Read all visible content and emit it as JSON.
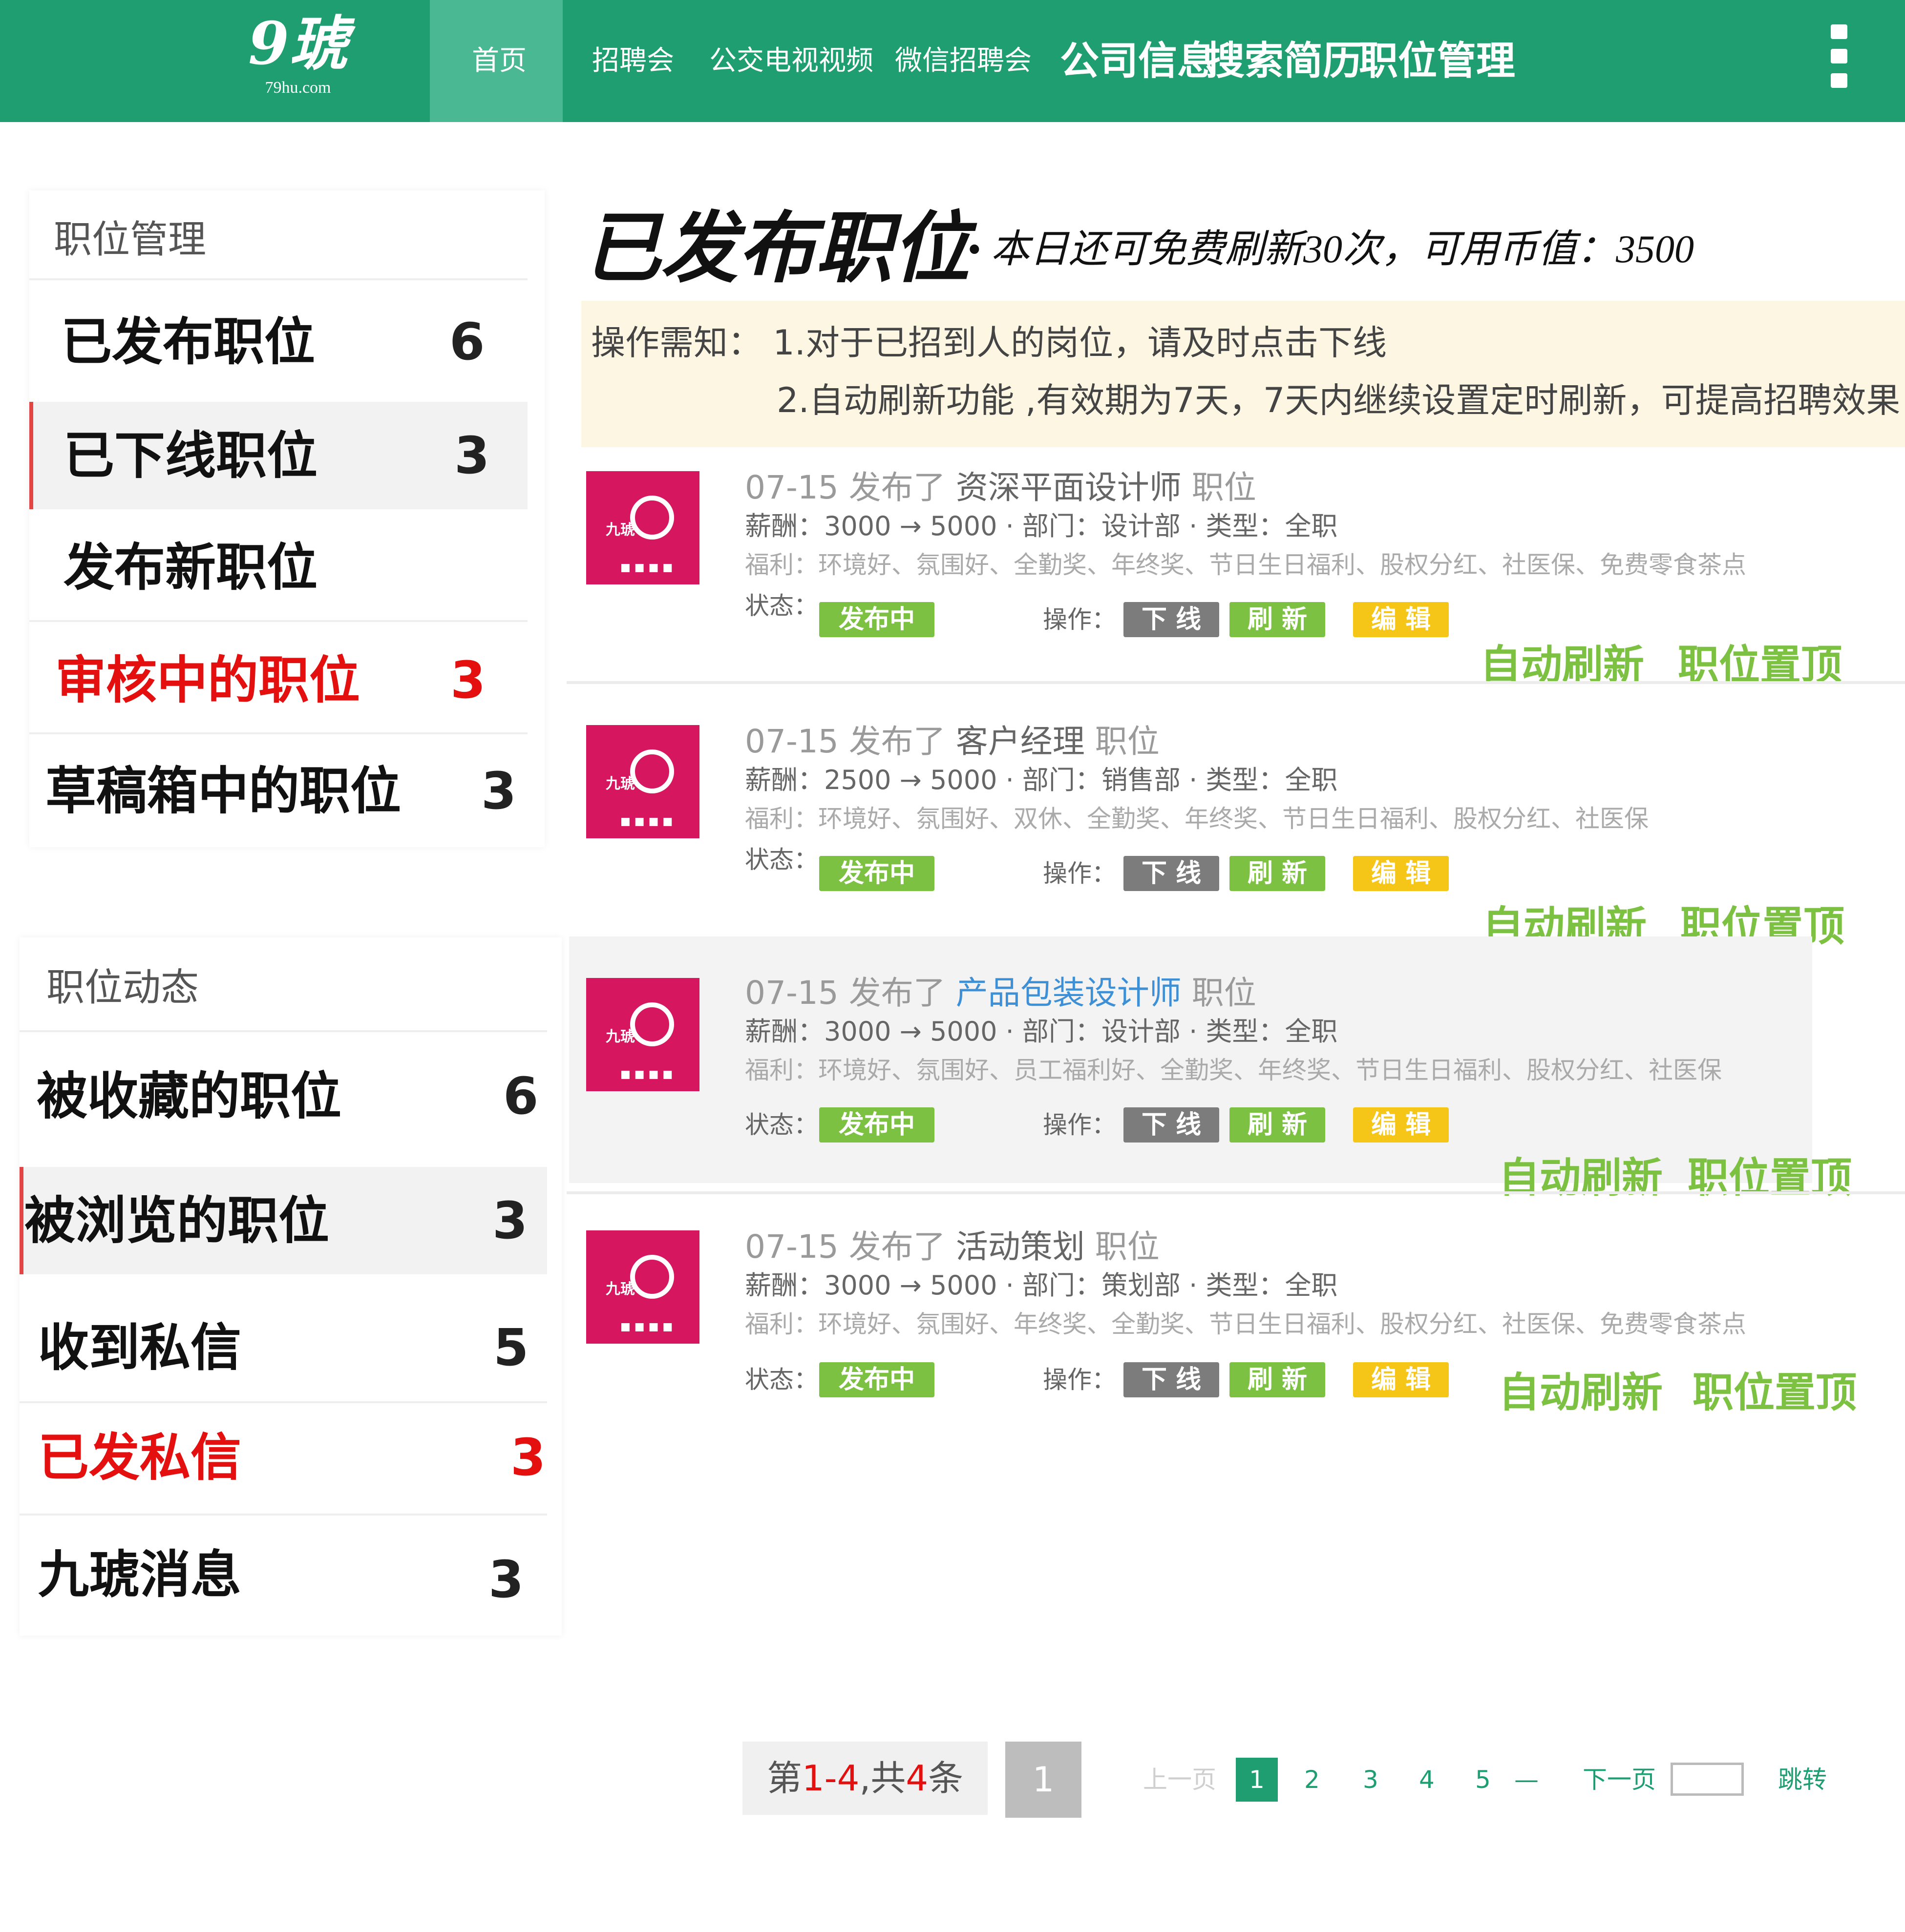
{
  "header": {
    "logo_mark": "9琥",
    "logo_sub": "79hu.com",
    "nav": [
      "首页",
      "招聘会",
      "公交电视视频",
      "微信招聘会",
      "公司信息",
      "搜索简历",
      "职位管理"
    ]
  },
  "sidebar": {
    "section1_title": "职位管理",
    "section1_items": [
      {
        "label": "已发布职位",
        "count": "6"
      },
      {
        "label": "已下线职位",
        "count": "3"
      },
      {
        "label": "发布新职位",
        "count": ""
      },
      {
        "label": "审核中的职位",
        "count": "3"
      },
      {
        "label": "草稿箱中的职位",
        "count": "3"
      }
    ],
    "section2_title": "职位动态",
    "section2_items": [
      {
        "label": "被收藏的职位",
        "count": "6"
      },
      {
        "label": "被浏览的职位",
        "count": "3"
      },
      {
        "label": "收到私信",
        "count": "5"
      },
      {
        "label": "已发私信",
        "count": "3"
      },
      {
        "label": "九琥消息",
        "count": "3"
      }
    ]
  },
  "main": {
    "title": "已发布职位",
    "subtitle": "• 本日还可免费刷新30次，可用币值：3500",
    "notice_line1": "操作需知： 1.对于已招到人的岗位，请及时点击下线",
    "notice_line2": "2.自动刷新功能 ,有效期为7天，7天内继续设置定时刷新，可提高招聘效果"
  },
  "jobs": [
    {
      "date": "07-15 发布了",
      "position": "资深平面设计师",
      "suffix": "职位",
      "salary": "薪酬：3000 → 5000 · 部门：设计部 · 类型：全职",
      "welfare": "福利：环境好、氛围好、全勤奖、年终奖、节日生日福利、股权分红、社医保、免费零食茶点"
    },
    {
      "date": "07-15 发布了",
      "position": "客户经理",
      "suffix": "职位",
      "salary": "薪酬：2500 → 5000 · 部门：销售部 · 类型：全职",
      "welfare": "福利：环境好、氛围好、双休、全勤奖、年终奖、节日生日福利、股权分红、社医保"
    },
    {
      "date": "07-15 发布了",
      "position": "产品包装设计师",
      "suffix": "职位",
      "salary": "薪酬：3000 → 5000 · 部门：设计部 · 类型：全职",
      "welfare": "福利：环境好、氛围好、员工福利好、全勤奖、年终奖、节日生日福利、股权分红、社医保"
    },
    {
      "date": "07-15 发布了",
      "position": "活动策划",
      "suffix": "职位",
      "salary": "薪酬：3000 → 5000 · 部门：策划部 · 类型：全职",
      "welfare": "福利：环境好、氛围好、年终奖、全勤奖、节日生日福利、股权分红、社医保、免费零食茶点"
    }
  ],
  "job_labels": {
    "status_label": "状态：",
    "status_value": "发布中",
    "ops_label": "操作：",
    "op_offline": "下 线",
    "op_refresh": "刷 新",
    "op_edit": "编 辑",
    "auto_refresh": "自动刷新",
    "pin_top": "职位置顶",
    "thumb_text": "九琥"
  },
  "pagination": {
    "info_prefix": "第",
    "info_range_start": "1",
    "info_dash": "-",
    "info_range_end": "4",
    "info_mid": ",共",
    "info_total": "4",
    "info_suffix": "条",
    "current_box": "1",
    "prev": "上一页",
    "pages": [
      "1",
      "2",
      "3",
      "4",
      "5"
    ],
    "ellipsis": "—",
    "next": "下一页",
    "jump": "跳转"
  },
  "colors": {
    "brand_green": "#1f9e72",
    "accent_red": "#e3100f",
    "badge_green": "#7dc142",
    "badge_gray": "#7c7c7c",
    "badge_yellow": "#f5c518",
    "thumb_pink": "#d6175f"
  }
}
